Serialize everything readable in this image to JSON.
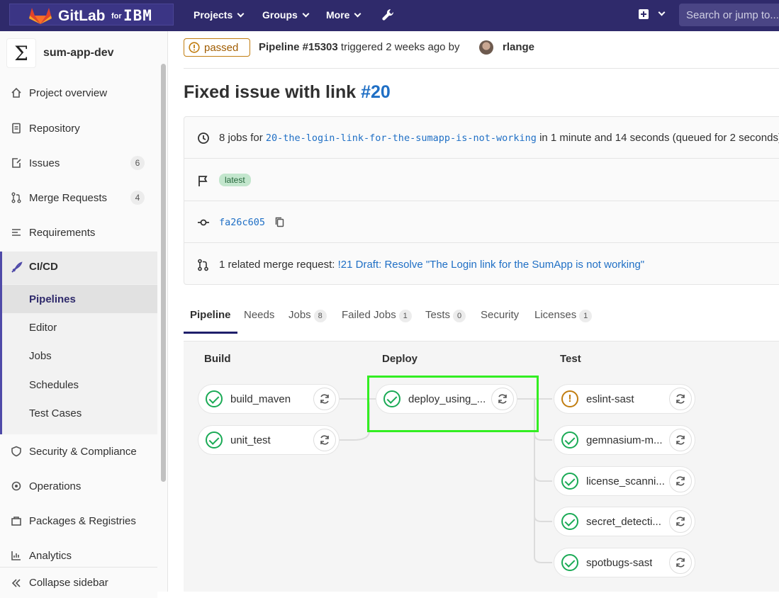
{
  "topnav": {
    "logo_text": "GitLab",
    "logo_for": "for",
    "logo_ibm": "IBM",
    "projects": "Projects",
    "groups": "Groups",
    "more": "More",
    "search_placeholder": "Search or jump to..."
  },
  "sidebar": {
    "project_avatar": "Σ",
    "project_name": "sum-app-dev",
    "items": [
      {
        "label": "Project overview",
        "icon": "home-icon"
      },
      {
        "label": "Repository",
        "icon": "doc-icon"
      },
      {
        "label": "Issues",
        "icon": "issues-icon",
        "badge": "6"
      },
      {
        "label": "Merge Requests",
        "icon": "merge-request-icon",
        "badge": "4"
      },
      {
        "label": "Requirements",
        "icon": "requirements-icon"
      },
      {
        "label": "CI/CD",
        "icon": "rocket-icon"
      }
    ],
    "cicd_sub": [
      "Pipelines",
      "Editor",
      "Jobs",
      "Schedules",
      "Test Cases"
    ],
    "lower_items": [
      {
        "label": "Security & Compliance",
        "icon": "shield-icon"
      },
      {
        "label": "Operations",
        "icon": "cloud-gear-icon"
      },
      {
        "label": "Packages & Registries",
        "icon": "package-icon"
      },
      {
        "label": "Analytics",
        "icon": "chart-icon"
      }
    ],
    "collapse": "Collapse sidebar"
  },
  "header": {
    "status": "passed",
    "pipeline_label": "Pipeline #15303",
    "triggered_text": "triggered 2 weeks ago by",
    "user": "rlange"
  },
  "commit": {
    "title": "Fixed issue with link",
    "ref": "#20"
  },
  "info": {
    "jobs_prefix": "8 jobs for",
    "branch": "20-the-login-link-for-the-sumapp-is-not-working",
    "jobs_suffix": "in 1 minute and 14 seconds (queued for 2 seconds)",
    "latest": "latest",
    "sha": "fa26c605",
    "mr_prefix": "1 related merge request:",
    "mr_link": "!21 Draft: Resolve \"The Login link for the SumApp is not working\""
  },
  "tabs": [
    {
      "label": "Pipeline"
    },
    {
      "label": "Needs"
    },
    {
      "label": "Jobs",
      "count": "8"
    },
    {
      "label": "Failed Jobs",
      "count": "1"
    },
    {
      "label": "Tests",
      "count": "0"
    },
    {
      "label": "Security"
    },
    {
      "label": "Licenses",
      "count": "1"
    }
  ],
  "stages": [
    {
      "name": "Build",
      "jobs": [
        {
          "name": "build_maven",
          "status": "success"
        },
        {
          "name": "unit_test",
          "status": "success"
        }
      ]
    },
    {
      "name": "Deploy",
      "jobs": [
        {
          "name": "deploy_using_...",
          "status": "success"
        }
      ]
    },
    {
      "name": "Test",
      "jobs": [
        {
          "name": "eslint-sast",
          "status": "warning"
        },
        {
          "name": "gemnasium-m...",
          "status": "success"
        },
        {
          "name": "license_scanni...",
          "status": "success"
        },
        {
          "name": "secret_detecti...",
          "status": "success"
        },
        {
          "name": "spotbugs-sast",
          "status": "success"
        }
      ]
    }
  ],
  "colors": {
    "nav_bg": "#2f2a6b",
    "success": "#1aaa55",
    "warning": "#c17d10",
    "link": "#1f6fc5",
    "highlight": "#33ee22"
  }
}
